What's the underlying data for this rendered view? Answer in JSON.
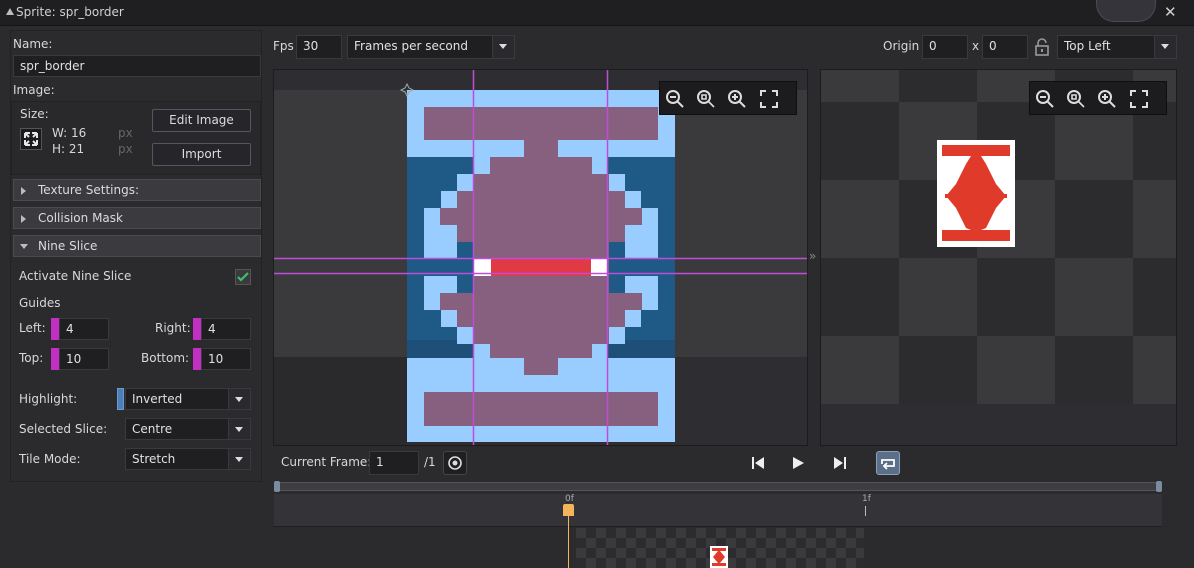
{
  "window": {
    "title": "Sprite: spr_border",
    "close_glyph": "✕"
  },
  "left_panel": {
    "name_label": "Name:",
    "name_value": "spr_border",
    "image_label": "Image:",
    "size_label": "Size:",
    "width_text": "W: 16",
    "height_text": "H: 21",
    "unit_w": "px",
    "unit_h": "px",
    "edit_image_label": "Edit Image",
    "import_label": "Import",
    "sections": {
      "texture": "Texture Settings:",
      "collision": "Collision Mask",
      "nine_slice": "Nine Slice"
    },
    "nine_slice": {
      "activate_label": "Activate Nine Slice",
      "activate_checked": true,
      "guides_label": "Guides",
      "left_label": "Left:",
      "left_value": "4",
      "right_label": "Right:",
      "right_value": "4",
      "top_label": "Top:",
      "top_value": "10",
      "bottom_label": "Bottom:",
      "bottom_value": "10",
      "highlight_label": "Highlight:",
      "highlight_value": "Inverted",
      "selected_slice_label": "Selected Slice:",
      "selected_slice_value": "Centre",
      "tile_mode_label": "Tile Mode:",
      "tile_mode_value": "Stretch"
    }
  },
  "toolbar": {
    "fps_label": "Fps",
    "fps_value": "30",
    "fps_mode": "Frames per second",
    "origin_label": "Origin",
    "origin_x": "0",
    "origin_sep": "x",
    "origin_y": "0",
    "origin_preset": "Top Left"
  },
  "playback": {
    "current_frame_label": "Current Frame:",
    "current_frame_value": "1",
    "total_frames": "/1"
  },
  "timeline": {
    "marker_0": "0f",
    "marker_1": "1f"
  },
  "colors": {
    "accent": "#c22fc2",
    "guide": "#c04dd8",
    "sprite_light": "#99ccff",
    "sprite_dark": "#1f5a87",
    "sprite_fill": "#875f7f",
    "preview_red": "#e03a2a",
    "frame_marker": "#f4b45a"
  }
}
